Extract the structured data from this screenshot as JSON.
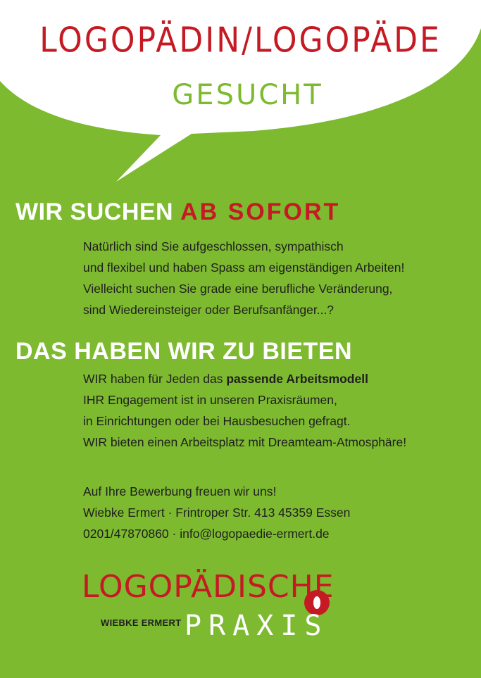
{
  "header": {
    "title": "LOGOPÄDIN/LOGOPÄDE",
    "subtitle": "GESUCHT"
  },
  "section1": {
    "title_white": "WIR SUCHEN",
    "title_red": "AB SOFORT",
    "lines": [
      "Natürlich sind Sie aufgeschlossen, sympathisch",
      "und flexibel und haben Spass am eigenständigen Arbeiten!",
      "Vielleicht suchen Sie grade eine berufliche Veränderung,",
      "sind Wiedereinsteiger oder Berufsanfänger...?"
    ]
  },
  "section2": {
    "title": "DAS HABEN  WIR ZU BIETEN",
    "line1_pre": "WIR haben für Jeden das ",
    "line1_bold": "passende Arbeitsmodell",
    "lines": [
      "IHR Engagement ist in unseren Praxisräumen,",
      "in Einrichtungen oder bei Hausbesuchen gefragt.",
      "WIR bieten einen Arbeitsplatz mit Dreamteam-Atmosphäre!"
    ]
  },
  "contact": {
    "lines": [
      "Auf Ihre Bewerbung freuen wir uns!",
      "Wiebke Ermert · Frintroper Str. 413 45359 Essen",
      "0201/47870860 · info@logopaedie-ermert.de"
    ]
  },
  "logo": {
    "top": "LOGOPÄDISCHE",
    "name": "WIEBKE ERMERT",
    "bottom": "PRAXIS"
  },
  "colors": {
    "background_green": "#7dba2f",
    "brand_red": "#c51a24",
    "bubble_white": "#ffffff",
    "text_dark": "#1f1f1f"
  }
}
